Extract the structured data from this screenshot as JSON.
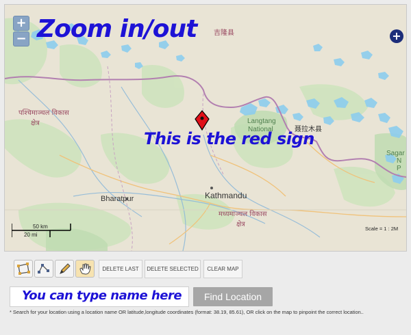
{
  "map": {
    "zoom_in_label": "+",
    "zoom_out_label": "−",
    "expand_icon": "plus-circle-icon",
    "marker_icon": "map-pin-icon",
    "places": {
      "jilong": "吉隆县",
      "langtang": "Langtang",
      "national": "National",
      "nyalam": "聂拉木县",
      "sagar": "Sagar",
      "sagar_n": "N",
      "sagar_p": "P",
      "west_region_a": "पश्चिमाञ्चल विकास",
      "west_region_b": "क्षेत्र",
      "bharatpur": "Bharatpur",
      "kathmandu": "Kathmandu",
      "central_region_a": "मध्यमाञ्चल विकास",
      "central_region_b": "क्षेत्र"
    },
    "scalebar": {
      "km": "50 km",
      "mi": "20 mi"
    },
    "scale_text": "Scale = 1 : 2M",
    "colors": {
      "water": "#7fc7ec",
      "park": "#cfe3be",
      "border": "#b57fb0",
      "marker": "#e01019"
    }
  },
  "annotations": {
    "zoom": "Zoom in/out",
    "red_sign": "This is the red sign",
    "type_name": "You can type name here"
  },
  "toolbar": {
    "tools": [
      {
        "icon": "polygon-icon"
      },
      {
        "icon": "polyline-icon"
      },
      {
        "icon": "pencil-icon"
      },
      {
        "icon": "hand-pan-icon"
      }
    ],
    "delete_last": "DELETE LAST",
    "delete_selected": "DELETE SELECTED",
    "clear_map": "CLEAR MAP"
  },
  "search": {
    "value": "",
    "button": "Find Location",
    "help": "* Search for your location using a location name OR latitude,longitude coordinates (format: 38.19, 85.61), OR click on the map to pinpoint the correct location.."
  }
}
